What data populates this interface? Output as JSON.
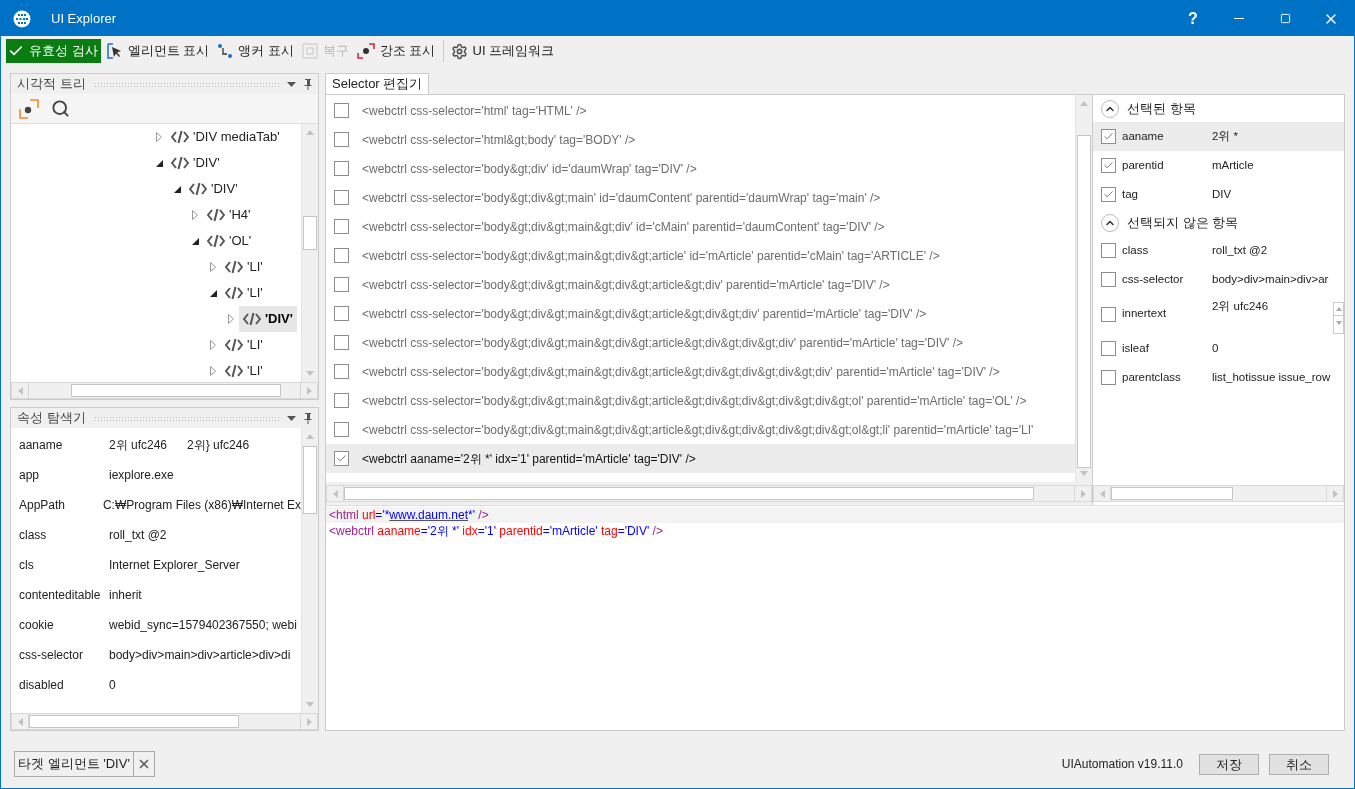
{
  "window": {
    "title": "UI Explorer",
    "help": "?"
  },
  "toolbar": [
    {
      "kind": "validate",
      "label": "유효성 검사",
      "disabled": false
    },
    {
      "kind": "element",
      "label": "엘리먼트 표시",
      "disabled": false
    },
    {
      "kind": "anchor",
      "label": "앵커 표시",
      "disabled": false
    },
    {
      "kind": "restore",
      "label": "복구",
      "disabled": true
    },
    {
      "kind": "highlight",
      "label": "강조 표시",
      "disabled": false
    },
    {
      "kind": "framework",
      "label": "UI 프레임워크",
      "disabled": false
    }
  ],
  "visual_tree": {
    "title": "시각적 트리",
    "items": [
      {
        "label": "'DIV  mediaTab'",
        "expanded": false,
        "selected": false
      },
      {
        "label": "'DIV'",
        "expanded": true,
        "selected": false,
        "children": [
          {
            "label": "'DIV'",
            "expanded": true,
            "selected": false,
            "children": [
              {
                "label": "'H4'",
                "expanded": false,
                "selected": false
              },
              {
                "label": "'OL'",
                "expanded": true,
                "selected": false,
                "children": [
                  {
                    "label": "'LI'",
                    "expanded": false,
                    "selected": false
                  },
                  {
                    "label": "'LI'",
                    "expanded": true,
                    "selected": false,
                    "children": [
                      {
                        "label": "'DIV'",
                        "expanded": false,
                        "selected": true
                      }
                    ]
                  },
                  {
                    "label": "'LI'",
                    "expanded": false,
                    "selected": false
                  },
                  {
                    "label": "'LI'",
                    "expanded": false,
                    "selected": false
                  }
                ]
              }
            ]
          }
        ]
      }
    ]
  },
  "property_explorer": {
    "title": "속성 탐색기",
    "rows": [
      {
        "name": "aaname",
        "value": "2위 ufc246      2위} ufc246"
      },
      {
        "name": "app",
        "value": "iexplore.exe"
      },
      {
        "name": "AppPath",
        "value": "C:₩Program Files (x86)₩Internet Ex"
      },
      {
        "name": "class",
        "value": "roll_txt @2"
      },
      {
        "name": "cls",
        "value": "Internet Explorer_Server"
      },
      {
        "name": "contenteditable",
        "value": "inherit"
      },
      {
        "name": "cookie",
        "value": "webid_sync=1579402367550; webi"
      },
      {
        "name": "css-selector",
        "value": "body>div>main>div>article>div>di"
      },
      {
        "name": "disabled",
        "value": "0"
      }
    ]
  },
  "selector_editor": {
    "tab": "Selector 편집기",
    "rows": [
      {
        "text": "<webctrl css-selector='html' tag='HTML' />",
        "checked": false,
        "selected": false
      },
      {
        "text": "<webctrl css-selector='html&gt;body' tag='BODY' />",
        "checked": false,
        "selected": false
      },
      {
        "text": "<webctrl css-selector='body&gt;div' id='daumWrap' tag='DIV' />",
        "checked": false,
        "selected": false
      },
      {
        "text": "<webctrl css-selector='body&gt;div&gt;main' id='daumContent' parentid='daumWrap' tag='main' />",
        "checked": false,
        "selected": false
      },
      {
        "text": "<webctrl css-selector='body&gt;div&gt;main&gt;div' id='cMain' parentid='daumContent' tag='DIV' />",
        "checked": false,
        "selected": false
      },
      {
        "text": "<webctrl css-selector='body&gt;div&gt;main&gt;div&gt;article' id='mArticle' parentid='cMain' tag='ARTICLE' />",
        "checked": false,
        "selected": false
      },
      {
        "text": "<webctrl css-selector='body&gt;div&gt;main&gt;div&gt;article&gt;div' parentid='mArticle' tag='DIV' />",
        "checked": false,
        "selected": false
      },
      {
        "text": "<webctrl css-selector='body&gt;div&gt;main&gt;div&gt;article&gt;div&gt;div' parentid='mArticle' tag='DIV' />",
        "checked": false,
        "selected": false
      },
      {
        "text": "<webctrl css-selector='body&gt;div&gt;main&gt;div&gt;article&gt;div&gt;div&gt;div' parentid='mArticle' tag='DIV' />",
        "checked": false,
        "selected": false
      },
      {
        "text": "<webctrl css-selector='body&gt;div&gt;main&gt;div&gt;article&gt;div&gt;div&gt;div&gt;div' parentid='mArticle' tag='DIV' />",
        "checked": false,
        "selected": false
      },
      {
        "text": "<webctrl css-selector='body&gt;div&gt;main&gt;div&gt;article&gt;div&gt;div&gt;div&gt;div&gt;ol' parentid='mArticle' tag='OL' />",
        "checked": false,
        "selected": false
      },
      {
        "text": "<webctrl css-selector='body&gt;div&gt;main&gt;div&gt;article&gt;div&gt;div&gt;div&gt;div&gt;ol&gt;li' parentid='mArticle' tag='LI'",
        "checked": false,
        "selected": false
      },
      {
        "text": "<webctrl aaname='2위 *' idx='1' parentid='mArticle' tag='DIV' />",
        "checked": true,
        "selected": true
      }
    ]
  },
  "attributes": [
    {
      "title": "선택된 항목",
      "expanded": true,
      "items": [
        {
          "name": "aaname",
          "value": "2위 *",
          "checked": true,
          "selected": true,
          "kind": "text"
        },
        {
          "name": "parentid",
          "value": "mArticle",
          "checked": true,
          "selected": false,
          "kind": "text"
        },
        {
          "name": "tag",
          "value": "DIV",
          "checked": true,
          "selected": false,
          "kind": "text"
        }
      ]
    },
    {
      "title": "선택되지 않은 항목",
      "expanded": true,
      "items": [
        {
          "name": "class",
          "value": "roll_txt @2",
          "checked": false,
          "selected": false,
          "kind": "text"
        },
        {
          "name": "css-selector",
          "value": "body>div>main>div>ar",
          "checked": false,
          "selected": false,
          "kind": "text"
        },
        {
          "name": "innertext",
          "value": "2위 ufc246",
          "checked": false,
          "selected": false,
          "kind": "multiline"
        },
        {
          "name": "isleaf",
          "value": "0",
          "checked": false,
          "selected": false,
          "kind": "text"
        },
        {
          "name": "parentclass",
          "value": "list_hotissue issue_row",
          "checked": false,
          "selected": false,
          "kind": "text"
        }
      ]
    }
  ],
  "xml_editor": {
    "lines": [
      [
        {
          "kind": "tag",
          "text": "<html"
        },
        {
          "kind": "attr",
          "text": " url"
        },
        {
          "kind": "punct",
          "text": "="
        },
        {
          "kind": "value",
          "text": "'*"
        },
        {
          "kind": "link",
          "text": "www.daum.net"
        },
        {
          "kind": "value",
          "text": "*'"
        },
        {
          "kind": "tag",
          "text": " />"
        }
      ],
      [
        {
          "kind": "tag",
          "text": "<webctrl"
        },
        {
          "kind": "attr",
          "text": " aaname"
        },
        {
          "kind": "punct",
          "text": "="
        },
        {
          "kind": "value",
          "text": "'2위 *'"
        },
        {
          "kind": "attr",
          "text": " idx"
        },
        {
          "kind": "punct",
          "text": "="
        },
        {
          "kind": "value",
          "text": "'1'"
        },
        {
          "kind": "attr",
          "text": " parentid"
        },
        {
          "kind": "punct",
          "text": "="
        },
        {
          "kind": "value",
          "text": "'mArticle'"
        },
        {
          "kind": "attr",
          "text": " tag"
        },
        {
          "kind": "punct",
          "text": "="
        },
        {
          "kind": "value",
          "text": "'DIV'"
        },
        {
          "kind": "tag",
          "text": " />"
        }
      ]
    ]
  },
  "footer": {
    "target": "타겟 엘리먼트 'DIV'",
    "version": "UIAutomation v19.11.0",
    "buttons": [
      "저장",
      "취소"
    ]
  }
}
